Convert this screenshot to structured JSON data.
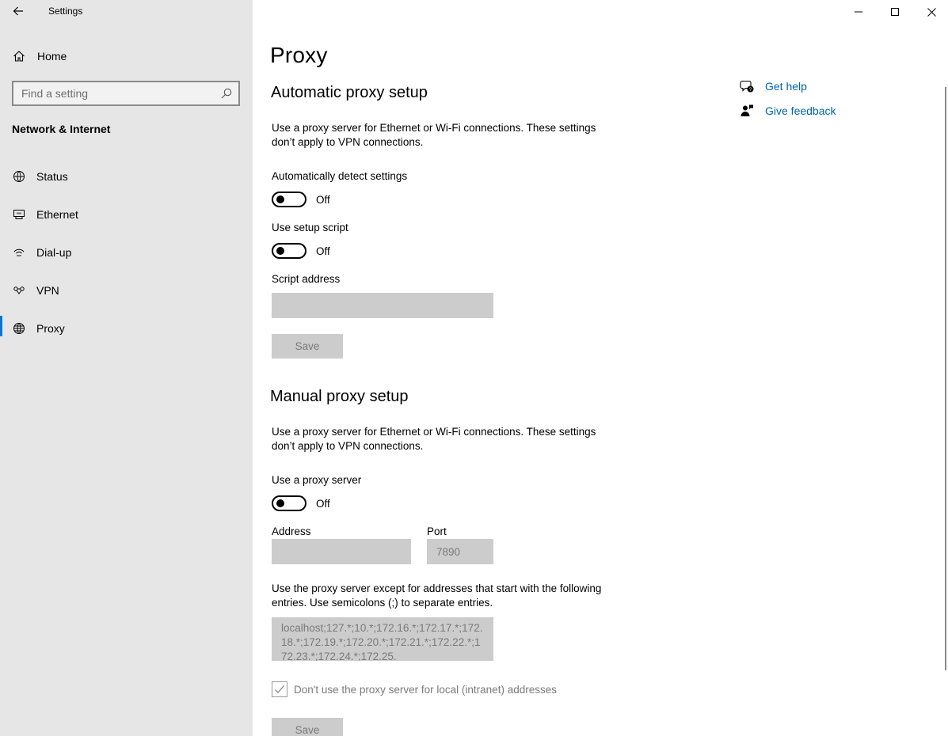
{
  "app": {
    "title": "Settings"
  },
  "sidebar": {
    "home_label": "Home",
    "search_placeholder": "Find a setting",
    "section_title": "Network & Internet",
    "items": [
      {
        "label": "Status",
        "icon": "status-icon"
      },
      {
        "label": "Ethernet",
        "icon": "ethernet-icon"
      },
      {
        "label": "Dial-up",
        "icon": "dialup-icon"
      },
      {
        "label": "VPN",
        "icon": "vpn-icon"
      },
      {
        "label": "Proxy",
        "icon": "globe-icon",
        "active": true
      }
    ]
  },
  "main": {
    "title": "Proxy",
    "automatic": {
      "heading": "Automatic proxy setup",
      "description": "Use a proxy server for Ethernet or Wi-Fi connections. These settings don’t apply to VPN connections.",
      "auto_detect_label": "Automatically detect settings",
      "auto_detect_state": "Off",
      "setup_script_label": "Use setup script",
      "setup_script_state": "Off",
      "script_address_label": "Script address",
      "script_address_value": "",
      "save_label": "Save"
    },
    "manual": {
      "heading": "Manual proxy setup",
      "description": "Use a proxy server for Ethernet or Wi-Fi connections. These settings don’t apply to VPN connections.",
      "use_proxy_label": "Use a proxy server",
      "use_proxy_state": "Off",
      "address_label": "Address",
      "address_value": "",
      "port_label": "Port",
      "port_value": "7890",
      "exceptions_description": "Use the proxy server except for addresses that start with the following entries. Use semicolons (;) to separate entries.",
      "exceptions_value": "localhost;127.*;10.*;172.16.*;172.17.*;172.18.*;172.19.*;172.20.*;172.21.*;172.22.*;172.23.*;172.24.*;172.25.",
      "local_bypass_label": "Don't use the proxy server for local (intranet) addresses",
      "local_bypass_checked": true,
      "save_label": "Save"
    },
    "help": {
      "get_help_label": "Get help",
      "feedback_label": "Give feedback"
    }
  },
  "colors": {
    "accent": "#0078d7",
    "link": "#0063b1",
    "sidebar_bg": "#e6e6e6",
    "disabled_bg": "#cccccc"
  }
}
